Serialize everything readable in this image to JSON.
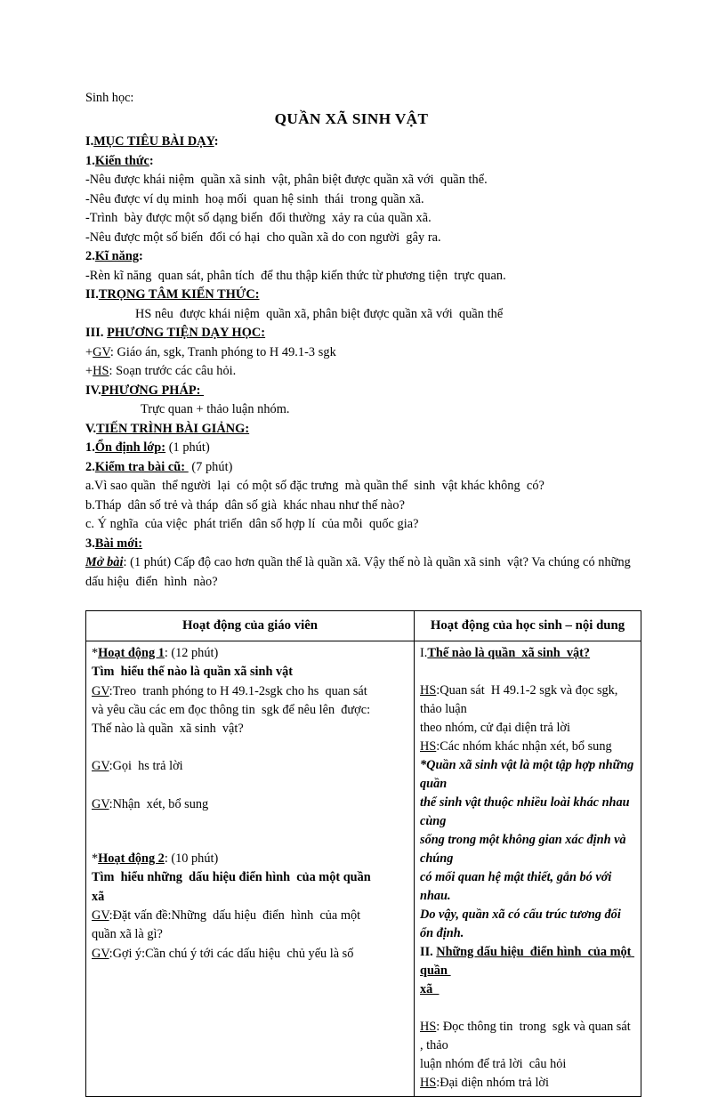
{
  "document": {
    "subject_label": "Sinh học:",
    "title": "QUẦN XÃ SINH VẬT"
  },
  "sections": {
    "objectives": {
      "heading_number": "I.",
      "heading": "MỤC TIÊU BÀI DẠY",
      "heading_colon": ":",
      "sub1_number": "1.",
      "sub1_heading": "Kiến thức",
      "sub1_colon": ":",
      "sub1_items": [
        "-Nêu được khái niệm  quần xã sinh  vật, phân biệt được quần xã với  quần thể.",
        "-Nêu được ví dụ minh  hoạ mối  quan hệ sinh  thái  trong quần xã.",
        "-Trình  bày được một số dạng biến  đổi thường  xảy ra của quần xã.",
        "-Nêu được một số biến  đổi có hại  cho quần xã do con người  gây ra."
      ],
      "sub2_number": "2.",
      "sub2_heading": "Kĩ năng",
      "sub2_colon": ":",
      "sub2_items": [
        "-Rèn kĩ năng  quan sát, phân tích  để thu thập kiến thức từ phương tiện  trực quan."
      ]
    },
    "focus": {
      "heading_number": "II.",
      "heading": "TRỌNG TÂM KIẾN THỨC:",
      "body": "HS nêu  được khái niệm  quần xã, phân biệt được quần xã với  quần thể"
    },
    "means": {
      "heading_number": "III. ",
      "heading": "PHƯƠNG TIỆN DẠY HỌC:",
      "items": [
        {
          "prefix": "+",
          "abbr": "GV",
          "rest": ": Giáo án, sgk, Tranh phóng to H 49.1-3 sgk"
        },
        {
          "prefix": "+",
          "abbr": "HS",
          "rest": ": Soạn trước các câu hỏi."
        }
      ]
    },
    "method": {
      "heading_number": "IV.",
      "heading": "PHƯƠNG PHÁP: ",
      "body": "Trực quan + thảo luận nhóm."
    },
    "procedure": {
      "heading_number": "V.",
      "heading": "TIẾN TRÌNH BÀI GIẢNG:",
      "step1_number": "1.",
      "step1_heading": "Ổn định lớp:",
      "step1_time": " (1 phút)",
      "step2_number": "2.",
      "step2_heading": "Kiểm tra bài cũ: ",
      "step2_time": " (7 phút)",
      "step2_questions": [
        "a.Vì sao quần  thể người  lại  có một số đặc trưng  mà quần thể  sinh  vật khác không  có?",
        "b.Tháp  dân số trẻ và tháp  dân số già  khác nhau như thế nào?",
        "c. Ý nghĩa  của việc  phát triển  dân số hợp lí  của mỗi  quốc gia?"
      ],
      "step3_number": "3.",
      "step3_heading": "Bài mới:",
      "intro_label": "Mở bài",
      "intro_text": ": (1 phút) Cấp độ cao hơn quần thể là quần xã. Vậy thế nò là quần xã sinh  vật? Va chúng có những  dấu hiệu  điển  hình  nào?"
    }
  },
  "table": {
    "headers": {
      "teacher": "Hoạt động của giáo viên",
      "student": "Hoạt động của học sinh – nội dung"
    },
    "teacher_column": {
      "activity1_marker": "*",
      "activity1_label": "Hoạt động 1",
      "activity1_time": ": (12 phút)",
      "activity1_subtitle": "Tìm  hiểu thế nào là quần xã sinh vật",
      "activity1_lines": [
        {
          "abbr": "GV",
          "rest": ":Treo  tranh phóng to H 49.1-2sgk cho hs  quan sát"
        },
        {
          "abbr": "",
          "rest": "và yêu cầu các em đọc thông tin  sgk để nêu lên  được:"
        },
        {
          "abbr": "",
          "rest": "Thế nào là quần  xã sinh  vật?"
        }
      ],
      "activity1_line2": {
        "abbr": "GV",
        "rest": ":Gọi  hs trả lời"
      },
      "activity1_line3": {
        "abbr": "GV",
        "rest": ":Nhận  xét, bổ sung"
      },
      "activity2_marker": "*",
      "activity2_label": "Hoạt động 2",
      "activity2_time": ": (10 phút)",
      "activity2_subtitle": "Tìm  hiểu những  dấu hiệu điển hình  của một quần",
      "activity2_subtitle2": "xã",
      "activity2_lines": [
        {
          "abbr": "GV",
          "rest": ":Đặt vấn đề:Những  dấu hiệu  điển  hình  của một"
        },
        {
          "abbr": "",
          "rest": "quần xã là gì?"
        },
        {
          "abbr": "GV",
          "rest": ":Gợi ý:Cần chú ý tới các dấu hiệu  chủ yếu là số"
        }
      ]
    },
    "student_column": {
      "heading1_number": "I.",
      "heading1": "Thế nào là quần  xã sinh  vật?",
      "lines1": [
        {
          "abbr": "HS",
          "rest": ":Quan sát  H 49.1-2 sgk và đọc sgk, thảo luận"
        },
        {
          "abbr": "",
          "rest": "theo nhóm, cử đại diện trả lời"
        },
        {
          "abbr": "HS",
          "rest": ":Các nhóm khác nhận xét, bổ sung"
        }
      ],
      "definition": [
        "*Quần xã sinh vật là một tập hợp những quần",
        "thể sinh vật thuộc nhiều loài khác nhau cùng",
        "sống trong một không gian xác định và chúng",
        "có mối quan hệ mật thiết, gắn bó với nhau.",
        "Do vậy, quần xã có cấu trúc tương đối ổn định."
      ],
      "heading2_number": "II. ",
      "heading2": "Những dấu hiệu  điển hình  của một quần ",
      "heading2_cont": "xã  ",
      "lines2": [
        {
          "abbr": "HS",
          "rest": ": Đọc thông tin  trong  sgk và quan sát , thảo"
        },
        {
          "abbr": "",
          "rest": "luận nhóm để trả lời  câu hỏi"
        },
        {
          "abbr": "HS",
          "rest": ":Đại diện nhóm trả lời"
        }
      ]
    }
  }
}
